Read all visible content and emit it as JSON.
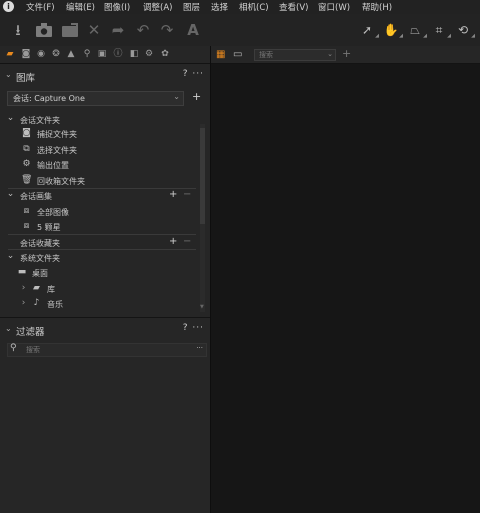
{
  "menubar": {
    "logo": "i",
    "items": [
      "文件(F)",
      "编辑(E)",
      "图像(I)",
      "调整(A)",
      "图层",
      "选择",
      "相机(C)",
      "查看(V)",
      "窗口(W)",
      "帮助(H)"
    ]
  },
  "toolbar": {
    "left_icons": [
      "import-icon",
      "camera-icon",
      "export-icon",
      "delete-icon",
      "lightning-icon",
      "undo-icon",
      "redo-icon",
      "text-auto-icon"
    ],
    "right_icons": [
      "pointer-icon",
      "pan-hand-icon",
      "keystone-icon",
      "crop-icon",
      "rotate-icon"
    ],
    "accent": "#e8891e"
  },
  "tool_tabs": [
    "library-tab",
    "capture-tab",
    "lens-tab",
    "color-tab",
    "exposure-tab",
    "details-tab",
    "adjustments-tab",
    "metadata-tab",
    "output-tab",
    "settings-tab",
    "batch-tab"
  ],
  "viewer_bar": {
    "search_placeholder": "搜索",
    "add": "+"
  },
  "library": {
    "title": "图库",
    "actions": "? ···",
    "session_value": "会话: Capture One",
    "session_add": "+",
    "session_folders": {
      "title": "会话文件夹",
      "items": [
        {
          "icon": "camera-icon",
          "label": "捕捉文件夹"
        },
        {
          "icon": "select-folder-icon",
          "label": "选择文件夹"
        },
        {
          "icon": "gear-icon",
          "label": "输出位置"
        },
        {
          "icon": "trash-icon",
          "label": "回收箱文件夹"
        }
      ]
    },
    "session_albums": {
      "title": "会话画集",
      "add": "+",
      "remove": "−",
      "items": [
        {
          "icon": "album-icon",
          "label": "全部图像"
        },
        {
          "icon": "album-icon",
          "label": "5 颗星"
        }
      ]
    },
    "session_favorites": {
      "title": "会话收藏夹",
      "add": "+",
      "remove": "−"
    },
    "system_folders": {
      "title": "系统文件夹",
      "items": [
        {
          "icon": "desktop-icon",
          "label": "桌面"
        },
        {
          "icon": "folder-icon",
          "label": "库"
        },
        {
          "icon": "music-icon",
          "label": "音乐"
        }
      ]
    }
  },
  "filters": {
    "title": "过滤器",
    "actions": "? ···",
    "search_placeholder": "搜索",
    "search_menu": "···"
  }
}
